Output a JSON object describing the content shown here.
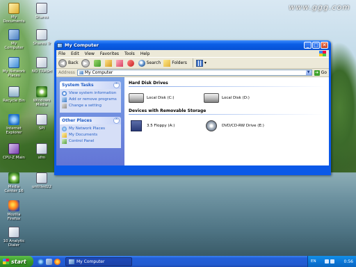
{
  "watermark": "www.ggg.com",
  "desktop_icons": [
    {
      "label": "My Documents"
    },
    {
      "label": "Shares"
    },
    {
      "label": "My Computer"
    },
    {
      "label": "Shares Tr"
    },
    {
      "label": "My Network Places"
    },
    {
      "label": "NO TRASH"
    },
    {
      "label": "Recycle Bin"
    },
    {
      "label": "Windows Media"
    },
    {
      "label": "Internet Explorer"
    },
    {
      "label": "SPI"
    },
    {
      "label": "CPU-Z Main"
    },
    {
      "label": "sfm"
    },
    {
      "label": "Media Center 16"
    },
    {
      "label": "untitled22"
    },
    {
      "label": "Mozilla Firefox"
    },
    {
      "label": "10 Analytic Dialer"
    }
  ],
  "window": {
    "title": "My Computer",
    "buttons": {
      "minimize": "_",
      "maximize": "□",
      "close": "✕"
    },
    "menu": [
      "File",
      "Edit",
      "View",
      "Favorites",
      "Tools",
      "Help"
    ],
    "toolbar": {
      "back": "Back",
      "search": "Search",
      "folders": "Folders"
    },
    "address": {
      "label": "Address",
      "value": "My Computer",
      "go": "Go"
    },
    "taskpane": {
      "system_tasks": {
        "title": "System Tasks",
        "items": [
          "View system information",
          "Add or remove programs",
          "Change a setting"
        ]
      },
      "other_places": {
        "title": "Other Places",
        "items": [
          "My Network Places",
          "My Documents",
          "Control Panel"
        ]
      }
    },
    "groups": {
      "hdd": {
        "title": "Hard Disk Drives",
        "items": [
          "Local Disk (C:)",
          "Local Disk (D:)"
        ]
      },
      "removable": {
        "title": "Devices with Removable Storage",
        "items": [
          "3.5 Floppy (A:)",
          "DVD/CD-RW Drive (E:)"
        ]
      }
    }
  },
  "taskbar": {
    "start": "start",
    "task_button": "My Computer",
    "lang": "EN",
    "clock": "0:56"
  }
}
